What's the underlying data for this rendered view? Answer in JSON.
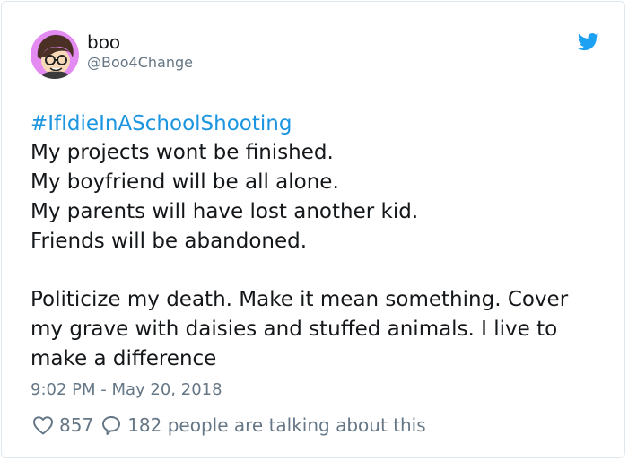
{
  "tweet": {
    "author_name": "boo",
    "author_handle": "@Boo4Change",
    "hashtag": "#IfIdieInASchoolShooting",
    "lines": [
      "My projects wont be finished.",
      "My boyfriend will be all alone.",
      "My parents will have lost another kid.",
      "Friends will be abandoned."
    ],
    "paragraph2_lines": [
      "Politicize my death. Make it mean something. Cover",
      "my grave with daisies and stuffed animals. I live to",
      "make a difference"
    ],
    "timestamp": "9:02 PM - May 20, 2018",
    "likes": "857",
    "replies_text": "182 people are talking about this"
  },
  "colors": {
    "link": "#1b95e0",
    "muted": "#657786",
    "text": "#14171a",
    "border": "#e1e8ed",
    "avatar_bg": "#e38bf0"
  },
  "icons": {
    "brand": "twitter-bird-icon",
    "like": "heart-icon",
    "reply": "speech-bubble-icon"
  }
}
